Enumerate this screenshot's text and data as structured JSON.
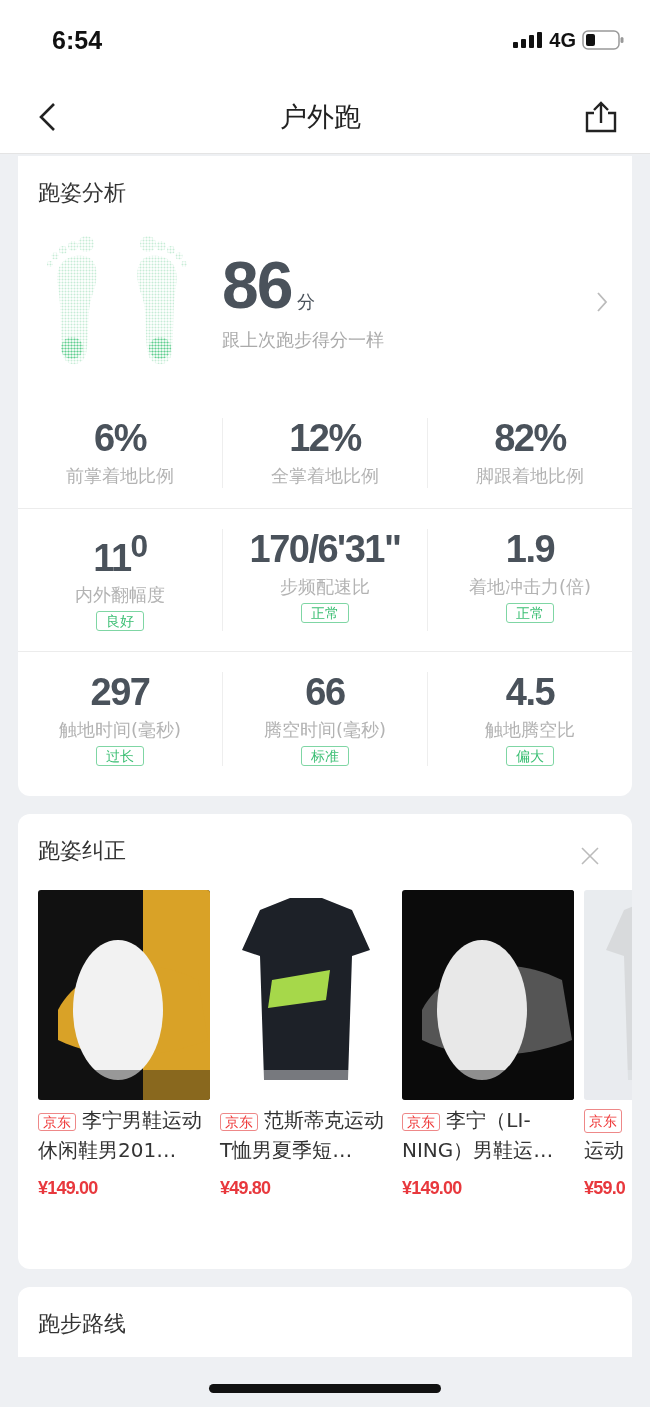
{
  "status_bar": {
    "time": "6:54",
    "network": "4G"
  },
  "nav": {
    "title": "户外跑"
  },
  "analysis": {
    "title": "跑姿分析",
    "score": "86",
    "score_unit": "分",
    "comparison": "跟上次跑步得分一样",
    "metric_rows": [
      [
        {
          "value": "6%",
          "label": "前掌着地比例"
        },
        {
          "value": "12%",
          "label": "全掌着地比例"
        },
        {
          "value": "82%",
          "label": "脚跟着地比例"
        }
      ],
      [
        {
          "value": "11$^{0}$",
          "label": "内外翻幅度",
          "tag": "良好"
        },
        {
          "value": "170/6'31\"",
          "label": "步频配速比",
          "tag": "正常"
        },
        {
          "value": "1.9",
          "label": "着地冲击力(倍)",
          "tag": "正常"
        }
      ],
      [
        {
          "value": "297",
          "label": "触地时间(毫秒)",
          "tag": "过长"
        },
        {
          "value": "66",
          "label": "腾空时间(毫秒)",
          "tag": "标准"
        },
        {
          "value": "4.5",
          "label": "触地腾空比",
          "tag": "偏大"
        }
      ]
    ]
  },
  "correction": {
    "title": "跑姿纠正",
    "products": [
      {
        "shop": "京东",
        "title": "李宁男鞋运动休闲鞋男201…",
        "price": "¥149.00"
      },
      {
        "shop": "京东",
        "title": "范斯蒂克运动T恤男夏季短…",
        "price": "¥49.80"
      },
      {
        "shop": "京东",
        "title": "李宁（LI-NING）男鞋运…",
        "price": "¥149.00"
      },
      {
        "shop": "京东",
        "title": "运动",
        "price": "¥59.0",
        "cut": true
      }
    ]
  },
  "route": {
    "title": "跑步路线"
  }
}
